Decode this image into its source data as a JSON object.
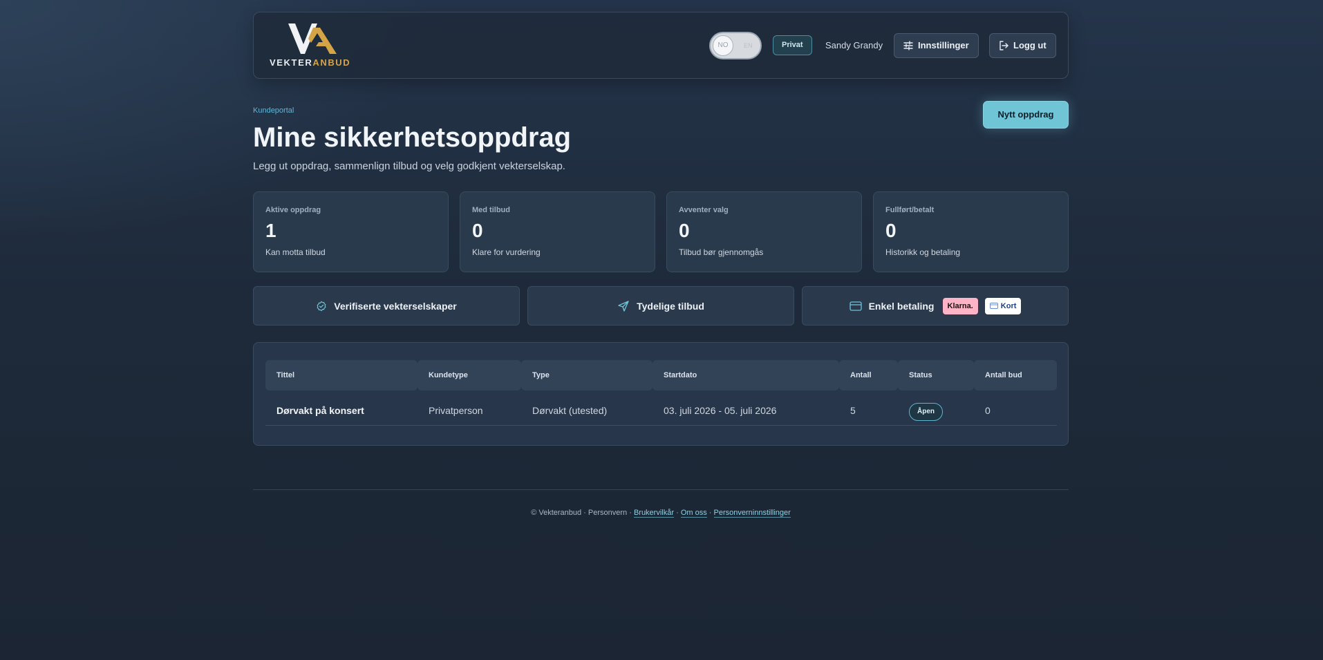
{
  "header": {
    "logo_text_a": "VEKTER",
    "logo_text_b": "ANBUD",
    "lang_active": "NO",
    "lang_other": "EN",
    "account_badge": "Privat",
    "user_name": "Sandy Grandy",
    "settings_label": "Innstillinger",
    "logout_label": "Logg ut"
  },
  "page": {
    "breadcrumb": "Kundeportal",
    "title": "Mine sikkerhetsoppdrag",
    "subtitle": "Legg ut oppdrag, sammenlign tilbud og velg godkjent vekterselskap.",
    "new_button": "Nytt oppdrag"
  },
  "stats": [
    {
      "label": "Aktive oppdrag",
      "value": "1",
      "desc": "Kan motta tilbud"
    },
    {
      "label": "Med tilbud",
      "value": "0",
      "desc": "Klare for vurdering"
    },
    {
      "label": "Avventer valg",
      "value": "0",
      "desc": "Tilbud bør gjennomgås"
    },
    {
      "label": "Fullført/betalt",
      "value": "0",
      "desc": "Historikk og betaling"
    }
  ],
  "features": {
    "verified": "Verifiserte vekterselskaper",
    "offers": "Tydelige tilbud",
    "payment": "Enkel betaling",
    "klarna": "Klarna.",
    "card": "Kort"
  },
  "table": {
    "columns": [
      "Tittel",
      "Kundetype",
      "Type",
      "Startdato",
      "Antall",
      "Status",
      "Antall bud"
    ],
    "rows": [
      {
        "title": "Dørvakt på konsert",
        "customer_type": "Privatperson",
        "type": "Dørvakt (utested)",
        "dates": "03. juli 2026 - 05. juli 2026",
        "count": "5",
        "status": "Åpen",
        "bids": "0"
      }
    ]
  },
  "footer": {
    "prefix": "© Vekteranbud · Personvern ·",
    "terms": "Brukervilkår",
    "about": "Om oss",
    "privacy_settings": "Personverninnstillinger",
    "sep": "·"
  },
  "colors": {
    "accent": "#6fc4d6",
    "gold": "#d4a447",
    "background": "#1e2a3a"
  }
}
